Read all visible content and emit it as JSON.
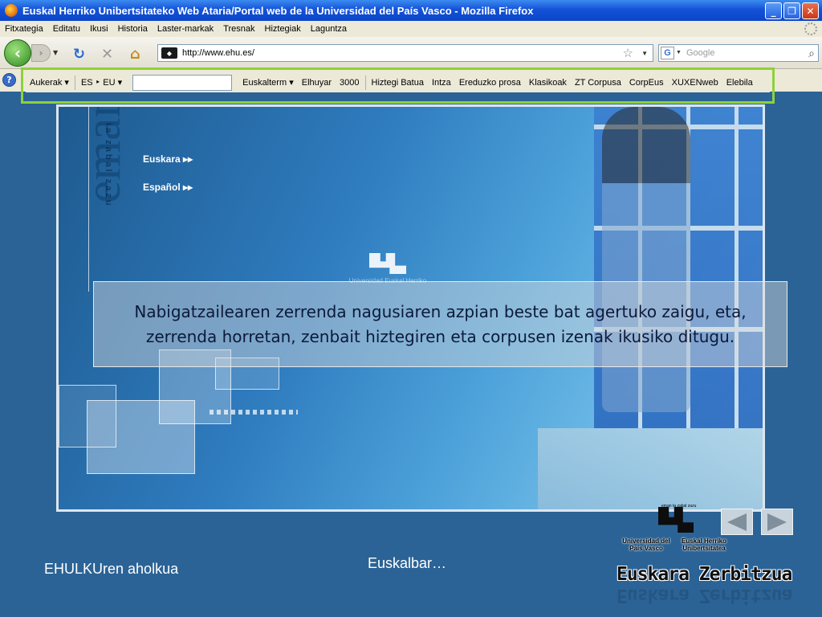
{
  "window": {
    "title": "Euskal Herriko Unibertsitateko Web Ataria/Portal web de la Universidad del País Vasco - Mozilla Firefox",
    "buttons": [
      "_",
      "❐",
      "✕"
    ]
  },
  "menubar": {
    "items": [
      "Fitxategia",
      "Editatu",
      "Ikusi",
      "Historia",
      "Laster-markak",
      "Tresnak",
      "Hiztegiak",
      "Laguntza"
    ]
  },
  "navbar": {
    "url": "http://www.ehu.es/",
    "search_placeholder": "Google",
    "search_engine_glyph": "G"
  },
  "euskalbar": {
    "language_menu": "Aukerak",
    "direction": "ES ‣ EU",
    "search_value": "",
    "dictionaries": [
      "Euskalterm",
      "Elhuyar",
      "3000",
      "Hiztegi Batua",
      "Intza",
      "Ereduzko prosa",
      "Klasikoak",
      "ZT Corpusa",
      "CorpEus",
      "XUXENweb",
      "Elebila"
    ],
    "highlight_color": "#8fd13a"
  },
  "page": {
    "lang_links": [
      "Euskara ▸▸",
      "Español ▸▸"
    ],
    "tagline": "ia zabal zazu",
    "brand": "eman",
    "center_logo_caption": "Universidad   Euskal Herriko"
  },
  "callout": {
    "text": "Nabigatzailearen zerrenda nagusiaren azpian beste bat agertuko zaigu, eta, zerrenda horretan, zenbait hiztegiren eta corpusen izenak ikusiko ditugu."
  },
  "footer": {
    "left_text": "EHULKUren aholkua",
    "center_text": "Euskalbar…",
    "logo_motto": "eman ta zabal zazu",
    "logo_name_es": "Universidad del País Vasco",
    "logo_name_eu": "Euskal Herriko Unibertsitatea",
    "service_name": "Euskara Zerbitzua"
  }
}
